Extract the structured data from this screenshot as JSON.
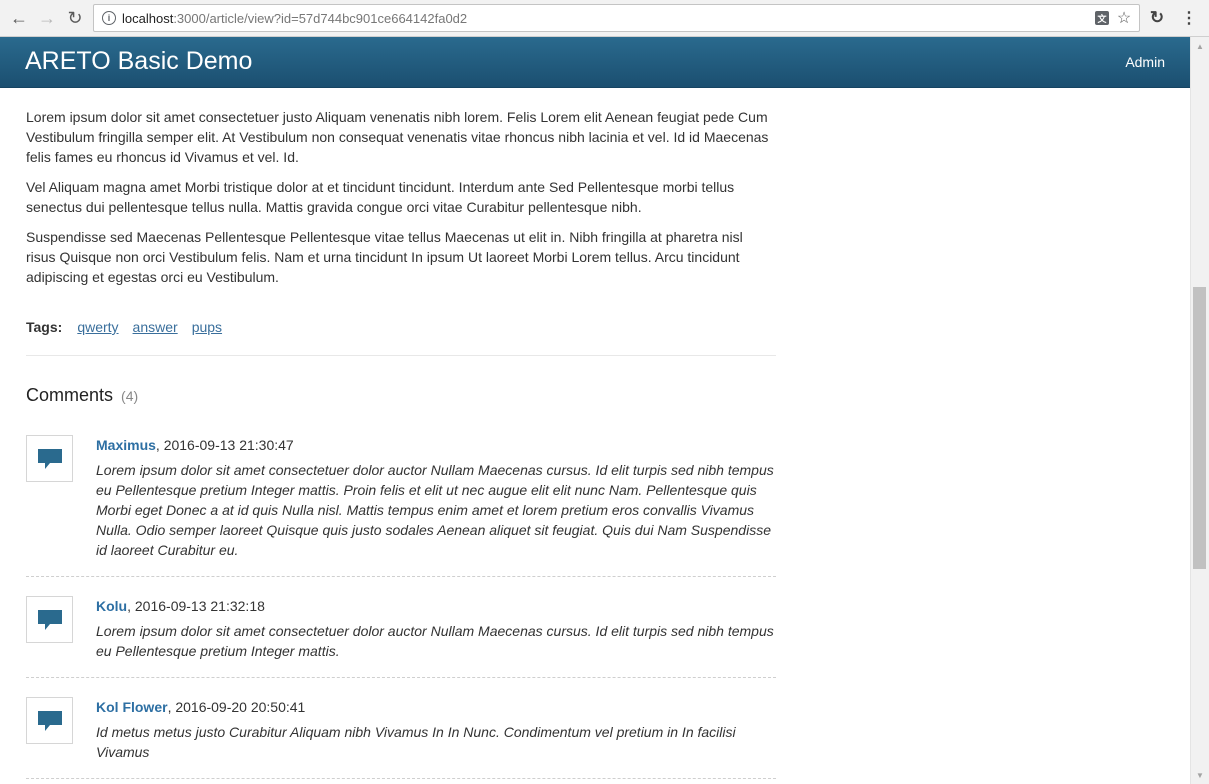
{
  "browser": {
    "url_host": "localhost",
    "url_rest": ":3000/article/view?id=57d744bc901ce664142fa0d2",
    "back_icon": "←",
    "forward_icon": "→",
    "reload_icon": "↻",
    "info_icon": "i",
    "translate_icon": "文",
    "star_icon": "☆",
    "extension_icon": "↻",
    "menu_icon": "⋮"
  },
  "header": {
    "brand": "ARETO Basic Demo",
    "admin_link": "Admin",
    "color": "#1f5a7d"
  },
  "article": {
    "paragraphs": [
      "Lorem ipsum dolor sit amet consectetuer justo Aliquam venenatis nibh lorem. Felis Lorem elit Aenean feugiat pede Cum Vestibulum fringilla semper elit. At Vestibulum non consequat venenatis vitae rhoncus nibh lacinia et vel. Id id Maecenas felis fames eu rhoncus id Vivamus et vel. Id.",
      "Vel Aliquam magna amet Morbi tristique dolor at et tincidunt tincidunt. Interdum ante Sed Pellentesque morbi tellus senectus dui pellentesque tellus nulla. Mattis gravida congue orci vitae Curabitur pellentesque nibh.",
      "Suspendisse sed Maecenas Pellentesque Pellentesque vitae tellus Maecenas ut elit in. Nibh fringilla at pharetra nisl risus Quisque non orci Vestibulum felis. Nam et urna tincidunt In ipsum Ut laoreet Morbi Lorem tellus. Arcu tincidunt adipiscing et egestas orci eu Vestibulum."
    ],
    "tags_label": "Tags:",
    "tags": [
      "qwerty",
      "answer",
      "pups"
    ]
  },
  "comments": {
    "title": "Comments",
    "count": "(4)",
    "items": [
      {
        "author": "Maximus",
        "date": ", 2016-09-13 21:30:47",
        "text": "Lorem ipsum dolor sit amet consectetuer dolor auctor Nullam Maecenas cursus. Id elit turpis sed nibh tempus eu Pellentesque pretium Integer mattis. Proin felis et elit ut nec augue elit elit nunc Nam. Pellentesque quis Morbi eget Donec a at id quis Nulla nisl. Mattis tempus enim amet et lorem pretium eros convallis Vivamus Nulla. Odio semper laoreet Quisque quis justo sodales Aenean aliquet sit feugiat. Quis dui Nam Suspendisse id laoreet Curabitur eu."
      },
      {
        "author": "Kolu",
        "date": ", 2016-09-13 21:32:18",
        "text": "Lorem ipsum dolor sit amet consectetuer dolor auctor Nullam Maecenas cursus. Id elit turpis sed nibh tempus eu Pellentesque pretium Integer mattis."
      },
      {
        "author": "Kol Flower",
        "date": ", 2016-09-20 20:50:41",
        "text": "Id metus metus justo Curabitur Aliquam nibh Vivamus In In Nunc. Condimentum vel pretium in In facilisi Vivamus"
      }
    ],
    "icon": "speech-bubble-icon",
    "icon_color": "#2a6a8e"
  }
}
